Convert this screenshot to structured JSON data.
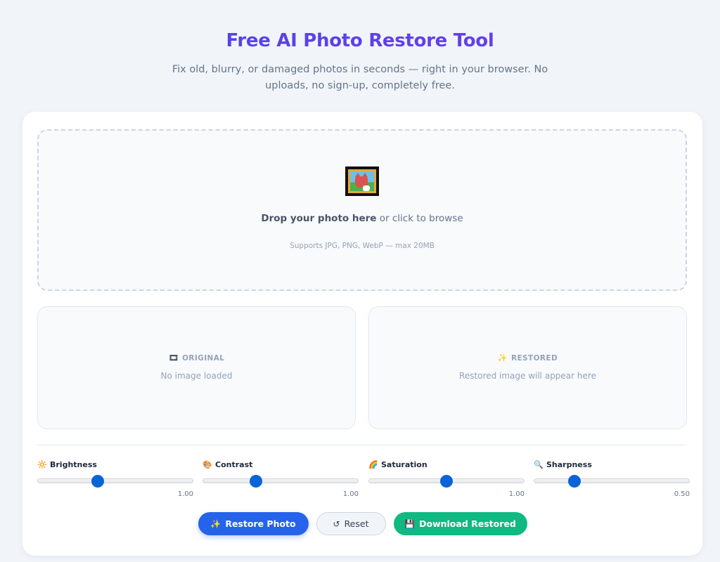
{
  "header": {
    "title": "Free AI Photo Restore Tool",
    "subtitle": "Fix old, blurry, or damaged photos in seconds — right in your browser. No uploads, no sign-up, completely free."
  },
  "dropzone": {
    "icon": "framed-picture-icon",
    "strong_text": "Drop your photo here",
    "text": " or click to browse",
    "hint": "Supports JPG, PNG, WebP — max 20MB"
  },
  "panels": {
    "original": {
      "icon_glyph": "🎞",
      "label": "ORIGINAL",
      "message": "No image loaded"
    },
    "restored": {
      "icon_glyph": "✨",
      "label": "RESTORED",
      "message": "Restored image will appear here"
    }
  },
  "sliders": [
    {
      "icon": "sun-icon",
      "icon_glyph": "🔆",
      "label": "Brightness",
      "value_text": "1.00",
      "fraction": 0.385
    },
    {
      "icon": "palette-icon",
      "icon_glyph": "🎨",
      "label": "Contrast",
      "value_text": "1.00",
      "fraction": 0.34
    },
    {
      "icon": "rainbow-icon",
      "icon_glyph": "🌈",
      "label": "Saturation",
      "value_text": "1.00",
      "fraction": 0.5
    },
    {
      "icon": "magnifier-icon",
      "icon_glyph": "🔍",
      "label": "Sharpness",
      "value_text": "0.50",
      "fraction": 0.26
    }
  ],
  "actions": {
    "restore": {
      "icon_glyph": "✨",
      "label": "Restore Photo"
    },
    "reset": {
      "icon_glyph": "↺",
      "label": "Reset"
    },
    "download": {
      "icon_glyph": "💾",
      "label": "Download Restored"
    }
  },
  "colors": {
    "accent": "#4f46e5",
    "primary_button": "#2563eb",
    "download_button": "#10b981",
    "slider_thumb": "#0a64d6"
  }
}
